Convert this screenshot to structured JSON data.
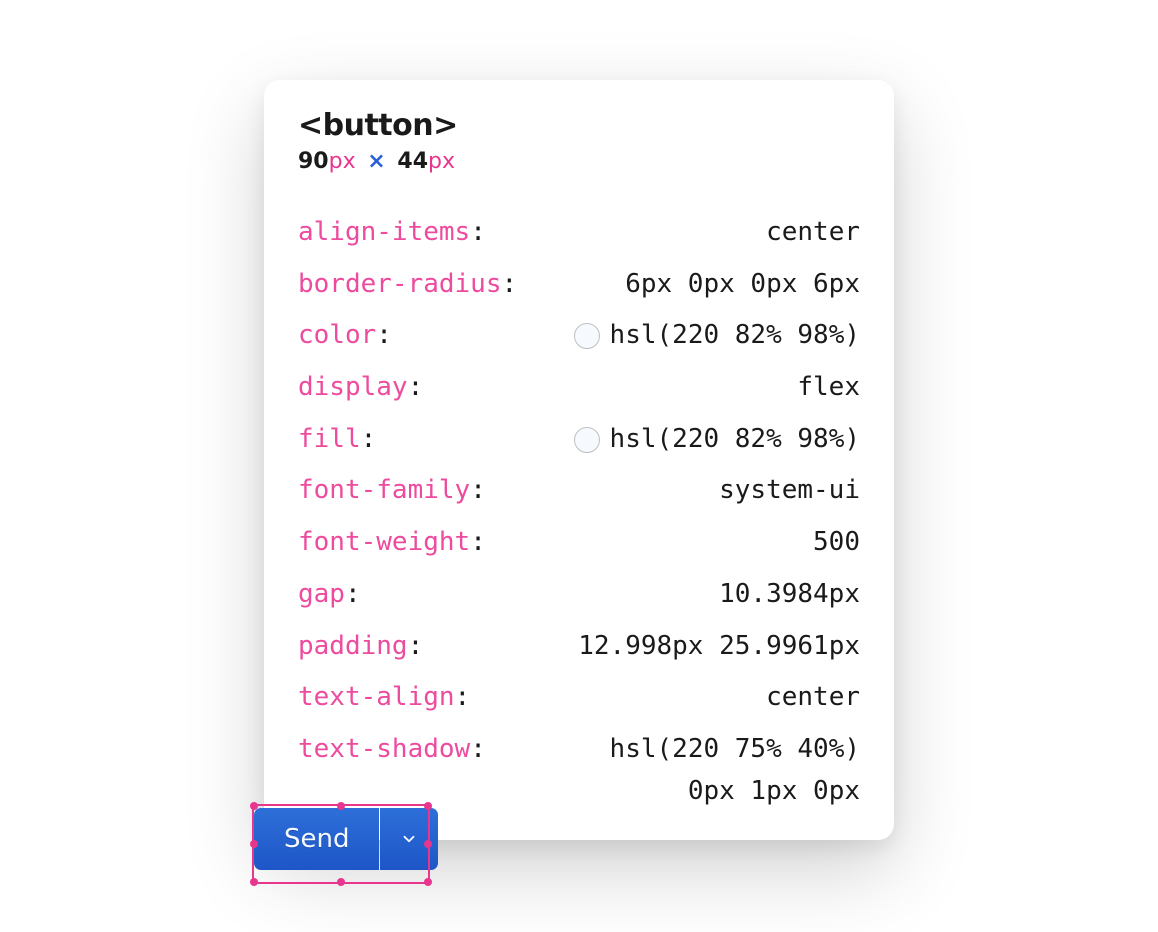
{
  "inspector": {
    "tag": "<button>",
    "width_value": "90",
    "height_value": "44",
    "px_unit": "px",
    "times_symbol": "×",
    "properties": [
      {
        "name": "align-items",
        "value": "center",
        "swatch": null
      },
      {
        "name": "border-radius",
        "value": "6px 0px 0px 6px",
        "swatch": null
      },
      {
        "name": "color",
        "value": "hsl(220 82% 98%)",
        "swatch": "hsl(220, 82%, 98%)"
      },
      {
        "name": "display",
        "value": "flex",
        "swatch": null
      },
      {
        "name": "fill",
        "value": "hsl(220 82% 98%)",
        "swatch": "hsl(220, 82%, 98%)"
      },
      {
        "name": "font-family",
        "value": "system-ui",
        "swatch": null
      },
      {
        "name": "font-weight",
        "value": "500",
        "swatch": null
      },
      {
        "name": "gap",
        "value": "10.3984px",
        "swatch": null
      },
      {
        "name": "padding",
        "value": "12.998px 25.9961px",
        "swatch": null
      },
      {
        "name": "text-align",
        "value": "center",
        "swatch": null
      },
      {
        "name": "text-shadow",
        "value_line1": "hsl(220 75% 40%)",
        "value_line2": "0px 1px 0px",
        "swatch": null
      }
    ]
  },
  "button": {
    "label": "Send"
  }
}
